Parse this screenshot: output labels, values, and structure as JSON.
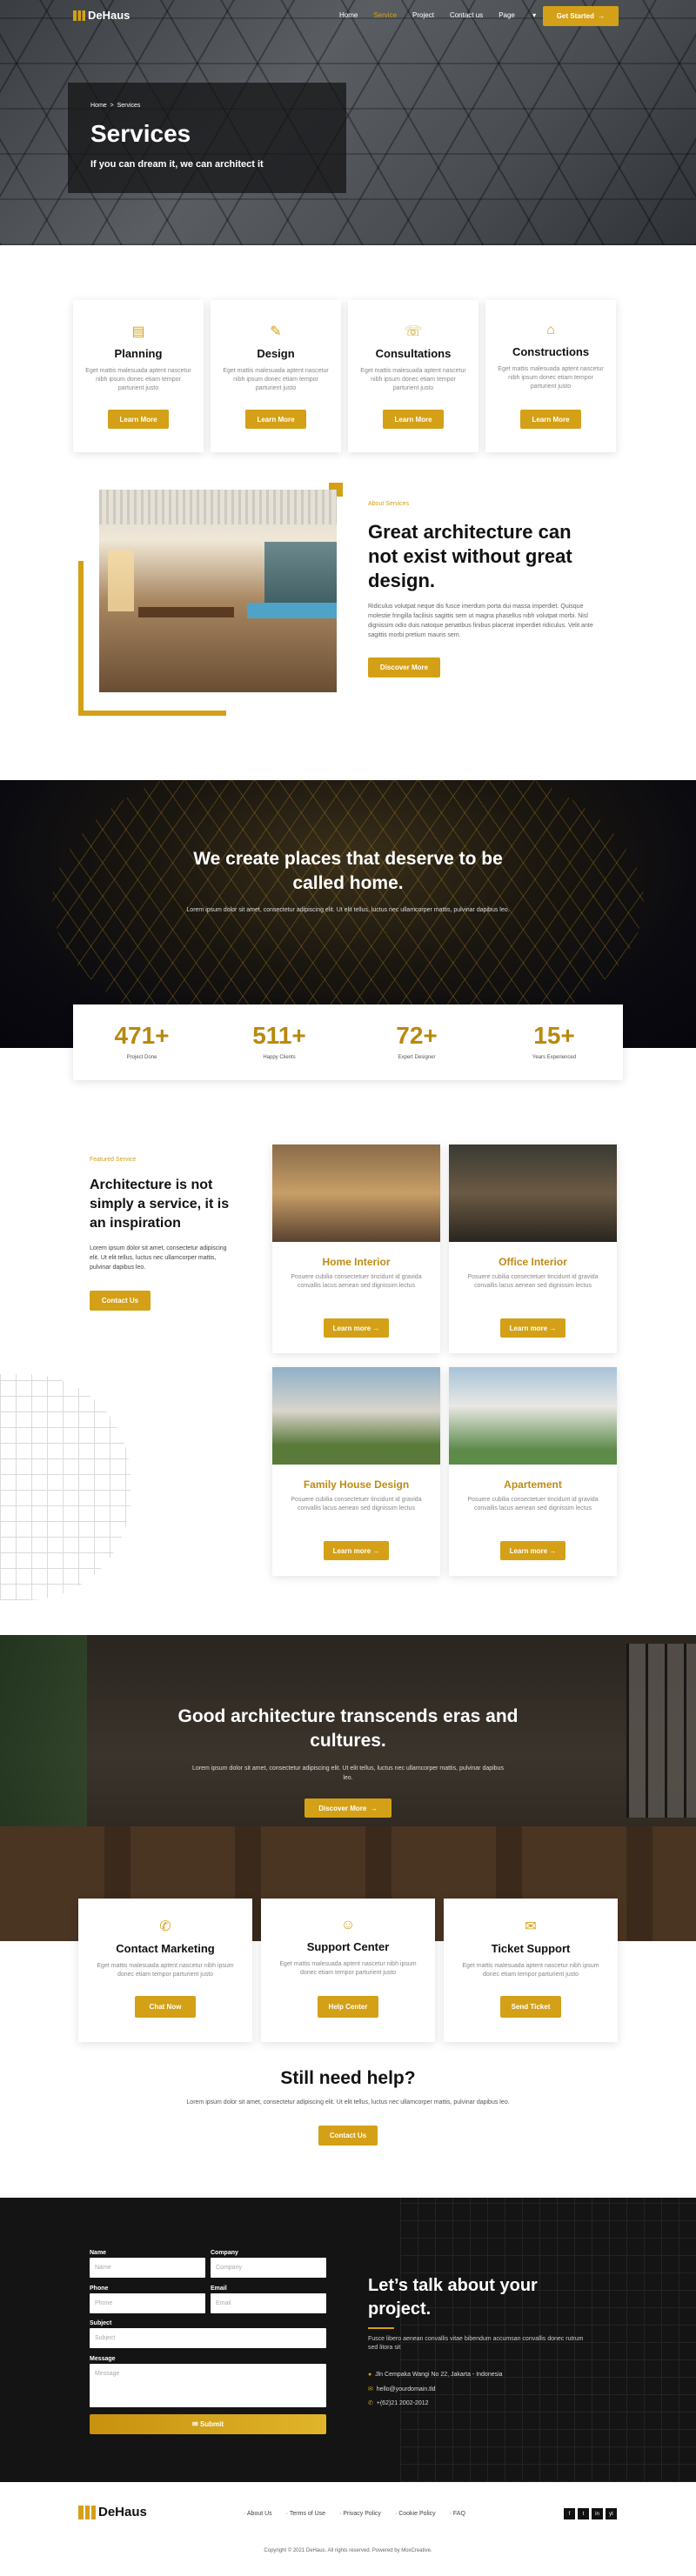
{
  "brand": {
    "name": "DeHaus"
  },
  "nav": {
    "items": [
      "Home",
      "Service",
      "Project",
      "Contact us",
      "Page"
    ],
    "page_caret": "▾",
    "cta": "Get Started",
    "cta_arrow": "→"
  },
  "hero": {
    "breadcrumb_home": "Home",
    "breadcrumb_sep": ">",
    "breadcrumb_current": "Services",
    "title": "Services",
    "subtitle": "If you can dream it, we can architect it"
  },
  "services": [
    {
      "icon": "planning-icon",
      "title": "Planning",
      "text": "Eget mattis malesuada aptent nascetur nibh ipsum donec etiam tempor parturient justo",
      "button": "Learn More"
    },
    {
      "icon": "design-icon",
      "title": "Design",
      "text": "Eget mattis malesuada aptent nascetur nibh ipsum donec etiam tempor parturient justo",
      "button": "Learn More"
    },
    {
      "icon": "consultations-icon",
      "title": "Consultations",
      "text": "Eget mattis malesuada aptent nascetur nibh ipsum donec etiam tempor parturient justo",
      "button": "Learn More"
    },
    {
      "icon": "constructions-icon",
      "title": "Constructions",
      "text": "Eget mattis malesuada aptent nascetur nibh ipsum donec etiam tempor parturient justo",
      "button": "Learn More"
    }
  ],
  "about": {
    "eyebrow": "About Services",
    "title": "Great architecture can not exist without great design.",
    "text": "Ridiculus volutpat neque dis fusce imerdum porta dui massa imperdiet. Quisque molestie fringilla facilisis sagittis sem ut magna phasellus nibh volutpat morbi. Nisl dignissim odio duis natoque penatibus finibus placerat imperdiet ridiculus. Velit ante sagittis morbi pretium mauris sem.",
    "button": "Discover More"
  },
  "places": {
    "title": "We create places that deserve to be called home.",
    "text": "Lorem ipsum dolor sit amet, consectetur adipiscing elit. Ut elit tellus, luctus nec ullamcorper mattis, pulvinar dapibus leo."
  },
  "stats": [
    {
      "value": "471+",
      "label": "Project Done"
    },
    {
      "value": "511+",
      "label": "Happy Clients"
    },
    {
      "value": "72+",
      "label": "Expert Designer"
    },
    {
      "value": "15+",
      "label": "Years Experienced"
    }
  ],
  "featured": {
    "eyebrow": "Featured Service",
    "title": "Architecture is not simply a service, it is an inspiration",
    "text": "Lorem ipsum dolor sit amet, consectetur adipiscing elit. Ut elit tellus, luctus nec ullamcorper mattis, pulvinar dapibus leo.",
    "button": "Contact Us",
    "cards": [
      {
        "title": "Home Interior",
        "text": "Posuere cubilia consectetuer tincidunt id gravida convallis lacus aenean sed dignissim lectus",
        "button": "Learn more →"
      },
      {
        "title": "Office Interior",
        "text": "Posuere cubilia consectetuer tincidunt id gravida convallis lacus aenean sed dignissim lectus",
        "button": "Learn more →"
      },
      {
        "title": "Family House Design",
        "text": "Posuere cubilia consectetuer tincidunt id gravida convallis lacus aenean sed dignissim lectus",
        "button": "Learn more →"
      },
      {
        "title": "Apartement",
        "text": "Posuere cubilia consectetuer tincidunt id gravida convallis lacus aenean sed dignissim lectus",
        "button": "Learn more →"
      }
    ]
  },
  "eras": {
    "title": "Good architecture transcends eras and cultures.",
    "text": "Lorem ipsum dolor sit amet, consectetur adipiscing elit. Ut elit tellus, luctus nec ullamcorper mattis, pulvinar dapibus leo.",
    "button": "Discover More"
  },
  "support": [
    {
      "icon": "contact-marketing-icon",
      "title": "Contact Marketing",
      "text": "Eget mattis malesuada aptent nascetur nibh ipsum donec etiam tempor parturient justo",
      "button": "Chat Now"
    },
    {
      "icon": "support-center-icon",
      "title": "Support Center",
      "text": "Eget mattis malesuada aptent nascetur nibh ipsum donec etiam tempor parturient justo",
      "button": "Help Center"
    },
    {
      "icon": "ticket-support-icon",
      "title": "Ticket Support",
      "text": "Eget mattis malesuada aptent nascetur nibh ipsum donec etiam tempor parturient justo",
      "button": "Send Ticket"
    }
  ],
  "help": {
    "title": "Still need help?",
    "text": "Lorem ipsum dolor sit amet, consectetur adipiscing elit. Ut elit tellus, luctus nec ullamcorper mattis, pulvinar dapibus leo.",
    "button": "Contact Us"
  },
  "form": {
    "name_label": "Name",
    "name_placeholder": "Name",
    "company_label": "Company",
    "company_placeholder": "Company",
    "phone_label": "Phone",
    "phone_placeholder": "Phone",
    "email_label": "Email",
    "email_placeholder": "Email",
    "subject_label": "Subject",
    "subject_placeholder": "Subject",
    "message_label": "Message",
    "message_placeholder": "Message",
    "submit": "Submit"
  },
  "talk": {
    "title": "Let’s talk about your project.",
    "text": "Fusce libero aenean convallis vitae bibendum accumsan convallis donec rutrum sed litora sit",
    "address": "Jln Cempaka Wangi No 22, Jakarta - Indonesia",
    "email": "hello@yourdomain.tld",
    "phone": "+(62)21 2002-2012"
  },
  "footer": {
    "links": [
      "About Us",
      "Terms of Use",
      "Privacy Policy",
      "Cookie Policy",
      "FAQ"
    ],
    "social": [
      "f",
      "t",
      "in",
      "yt"
    ],
    "copyright": "Copyright © 2021 DeHaus. All rights reserved. Powered by MoxCreative."
  },
  "colors": {
    "accent": "#d4a017",
    "dark": "#141414"
  }
}
